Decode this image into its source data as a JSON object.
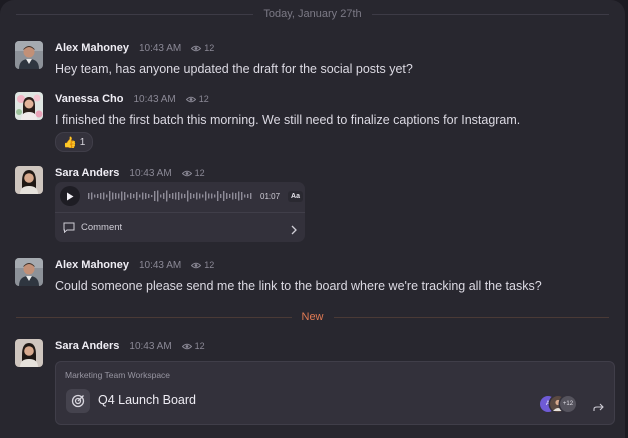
{
  "dividers": {
    "date": "Today, January 27th",
    "new": "New"
  },
  "messages": [
    {
      "author": "Alex Mahoney",
      "time": "10:43 AM",
      "views": "12",
      "text": "Hey team, has anyone updated the draft for the social posts yet?"
    },
    {
      "author": "Vanessa Cho",
      "time": "10:43 AM",
      "views": "12",
      "text": "I finished the first batch this morning. We still need to finalize captions for Instagram.",
      "reaction": {
        "emoji": "👍",
        "count": "1"
      }
    },
    {
      "author": "Sara Anders",
      "time": "10:43 AM",
      "views": "12",
      "audio": {
        "duration": "01:07",
        "speed_label": "Aa",
        "comment_label": "Comment"
      }
    },
    {
      "author": "Alex Mahoney",
      "time": "10:43 AM",
      "views": "12",
      "text": "Could someone please send me the link to the board where we're tracking all the tasks?"
    },
    {
      "author": "Sara Anders",
      "time": "10:43 AM",
      "views": "12",
      "board": {
        "workspace": "Marketing Team Workspace",
        "title": "Q4 Launch Board",
        "participant_initial": "A",
        "more_count": "+12"
      }
    }
  ],
  "icons": {
    "views": "eye-icon",
    "play": "play-icon",
    "comment": "comment-icon",
    "chevron": "chevron-right-icon",
    "board": "target-icon",
    "share": "share-arrow-icon"
  },
  "colors": {
    "accent_new": "#e07a54",
    "background": "#28272f",
    "card": "#33313b"
  }
}
